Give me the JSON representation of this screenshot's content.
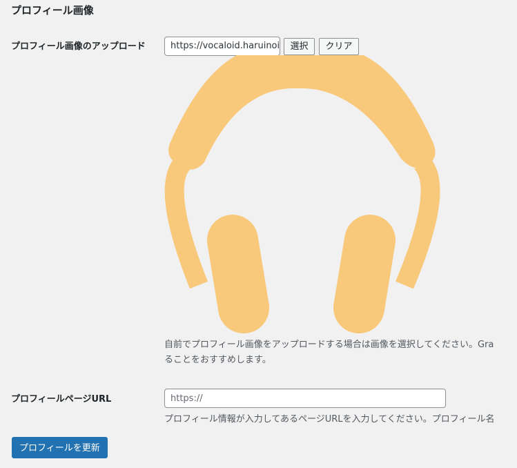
{
  "section": {
    "title": "プロフィール画像"
  },
  "upload": {
    "label": "プロフィール画像のアップロード",
    "url_value": "https://vocaloid.haruinoi",
    "select_label": "選択",
    "clear_label": "クリア",
    "preview_icon": "headphones-icon",
    "preview_color": "#f8c87b",
    "description_line1": "自前でプロフィール画像をアップロードする場合は画像を選択してください。Gra",
    "description_line2": "ることをおすすめします。"
  },
  "profile_page": {
    "label": "プロフィールページURL",
    "placeholder": "https://",
    "description": "プロフィール情報が入力してあるページURLを入力してください。プロフィール名"
  },
  "submit": {
    "label": "プロフィールを更新"
  }
}
